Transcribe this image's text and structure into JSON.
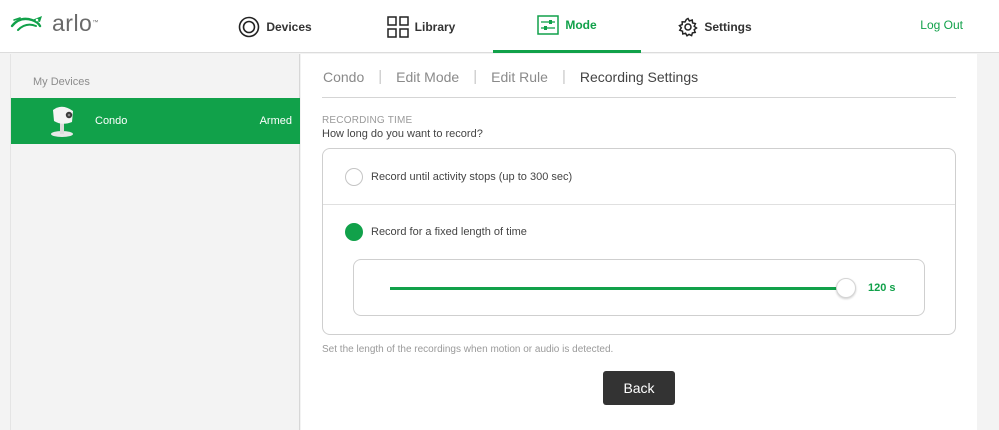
{
  "logo": {
    "text": "arlo",
    "tm": "™"
  },
  "nav": {
    "devices": "Devices",
    "library": "Library",
    "mode": "Mode",
    "settings": "Settings",
    "logout": "Log Out",
    "active": "Mode"
  },
  "sidebar": {
    "heading": "My Devices",
    "devices": [
      {
        "name": "Condo",
        "status": "Armed",
        "selected": true
      }
    ]
  },
  "breadcrumb": [
    {
      "label": "Condo"
    },
    {
      "label": "Edit Mode"
    },
    {
      "label": "Edit Rule"
    },
    {
      "label": "Recording Settings",
      "current": true
    }
  ],
  "recording": {
    "section_label": "RECORDING TIME",
    "question": "How long do you want to record?",
    "options": [
      {
        "label": "Record until activity stops (up to 300 sec)",
        "selected": false
      },
      {
        "label": "Record for a fixed length of time",
        "selected": true
      }
    ],
    "slider_value": "120 s",
    "hint": "Set the length of the recordings when motion or audio is detected."
  },
  "actions": {
    "back": "Back"
  },
  "colors": {
    "accent": "#11a14a",
    "dark_button": "#333333",
    "text": "#444444",
    "muted": "#9a9a9a"
  }
}
